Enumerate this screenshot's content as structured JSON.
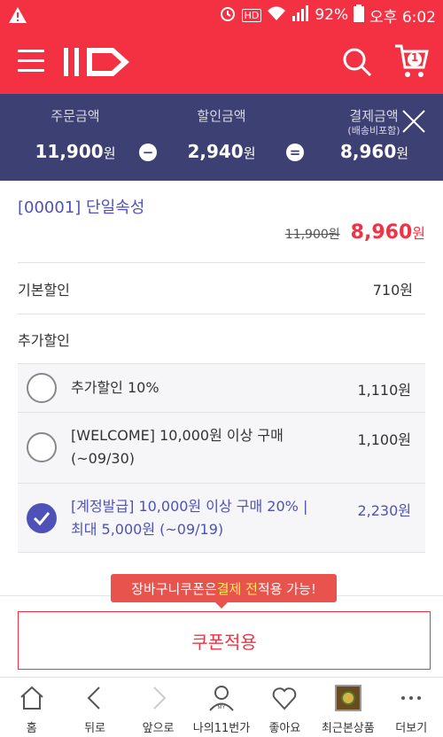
{
  "status_bar": {
    "hd": "HD",
    "battery": "92%",
    "time": "오후 6:02"
  },
  "header": {
    "logo": "11번가",
    "cart_count": "1"
  },
  "summary": {
    "order_label": "주문금액",
    "order_value": "11,900",
    "order_unit": "원",
    "discount_label": "할인금액",
    "discount_value": "2,940",
    "discount_unit": "원",
    "pay_label": "결제금액",
    "pay_sub": "(배송비포함)",
    "pay_value": "8,960",
    "pay_unit": "원",
    "minus": "−",
    "equals": "="
  },
  "product": {
    "title": "[00001] 단일속성",
    "original_price": "11,900원",
    "final_price": "8,960",
    "final_unit": "원"
  },
  "basic_discount": {
    "label": "기본할인",
    "amount": "710원"
  },
  "extra_discount": {
    "label": "추가할인"
  },
  "options": [
    {
      "line1": "추가할인 10%",
      "line2": "",
      "amount": "1,110원",
      "selected": false
    },
    {
      "line1": "[WELCOME] 10,000원 이상 구매",
      "line2": "(~09/30)",
      "amount": "1,100원",
      "selected": false
    },
    {
      "line1": "[계정발급] 10,000원 이상 구매 20% |",
      "line2": "최대 5,000원 (~09/19)",
      "amount": "2,230원",
      "selected": true
    }
  ],
  "tooltip": {
    "pre": "장바구니쿠폰은 ",
    "highlight": "결제 전",
    "post": " 적용 가능!"
  },
  "apply_button": "쿠폰적용",
  "nav": [
    {
      "label": "홈",
      "icon": "home-icon"
    },
    {
      "label": "뒤로",
      "icon": "back-icon"
    },
    {
      "label": "앞으로",
      "icon": "forward-icon"
    },
    {
      "label": "나의11번가",
      "icon": "my-icon"
    },
    {
      "label": "좋아요",
      "icon": "heart-icon"
    },
    {
      "label": "최근본상품",
      "icon": "recent-product-thumbnail"
    },
    {
      "label": "더보기",
      "icon": "more-icon"
    }
  ],
  "colors": {
    "brand": "#f43142",
    "summary_bg": "#3d4073",
    "accent": "#4e52b8"
  }
}
